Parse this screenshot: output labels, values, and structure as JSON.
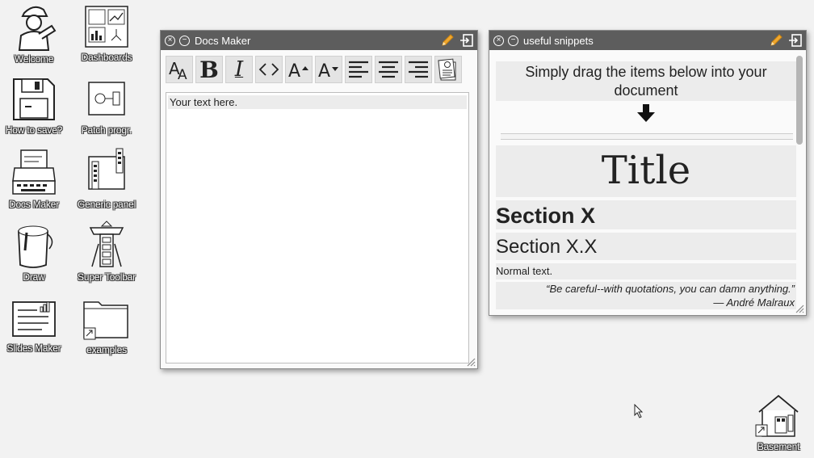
{
  "desktop": {
    "icons": [
      {
        "label": "Welcome",
        "icon": "person-icon"
      },
      {
        "label": "Dashboards",
        "icon": "dashboard-icon"
      },
      {
        "label": "How to save?",
        "icon": "floppy-disk-icon"
      },
      {
        "label": "Patch progr.",
        "icon": "patch-icon"
      },
      {
        "label": "Docs Maker",
        "icon": "typewriter-icon"
      },
      {
        "label": "Generic panel",
        "icon": "panel-icon"
      },
      {
        "label": "Draw",
        "icon": "paint-bucket-icon"
      },
      {
        "label": "Super Toolbar",
        "icon": "toolbar-icon"
      },
      {
        "label": "Slides Maker",
        "icon": "slides-icon"
      },
      {
        "label": "examples",
        "icon": "folder-icon"
      },
      {
        "label": "Basement",
        "icon": "house-icon"
      }
    ]
  },
  "docs_maker": {
    "title": "Docs Maker",
    "toolbar": [
      {
        "name": "font-size-icon"
      },
      {
        "name": "bold-icon",
        "glyph": "B"
      },
      {
        "name": "italic-icon",
        "glyph": "I"
      },
      {
        "name": "code-icon"
      },
      {
        "name": "increase-font-icon"
      },
      {
        "name": "decrease-font-icon"
      },
      {
        "name": "align-left-icon"
      },
      {
        "name": "align-center-icon"
      },
      {
        "name": "align-right-icon"
      },
      {
        "name": "stamp-icon"
      }
    ],
    "editor_text": "Your text here."
  },
  "snippets": {
    "title": "useful snippets",
    "intro": "Simply drag the items below into your document",
    "title_sample": "Title",
    "section": "Section X",
    "subsection": "Section X.X",
    "normal": "Normal text.",
    "quote": "“Be careful--with quotations, you can damn anything.”",
    "quote_author": "— André Malraux"
  },
  "colors": {
    "titlebar": "#5d5d5d",
    "pencil": "#f0a830",
    "desktop": "#f2f2f2"
  }
}
